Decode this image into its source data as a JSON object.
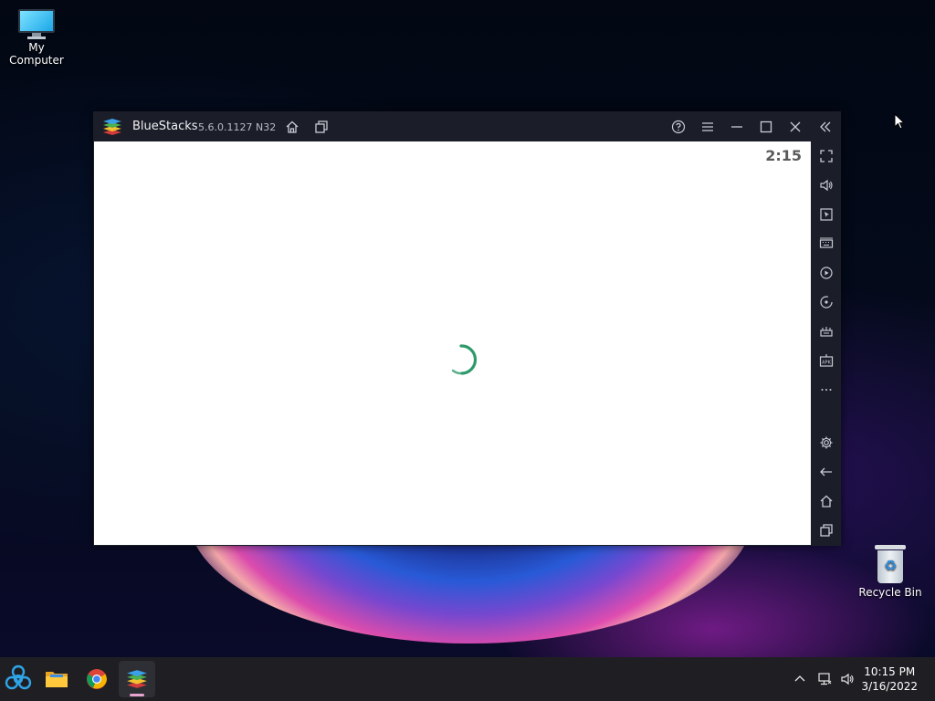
{
  "desktop": {
    "icons": [
      {
        "label": "My Computer",
        "icon": "computer-icon"
      },
      {
        "label": "Recycle Bin",
        "icon": "recycle-bin-icon"
      }
    ]
  },
  "window": {
    "app_name": "BlueStacks",
    "version": "5.6.0.1127 N32",
    "titlebar_buttons": [
      "home-icon",
      "multi-instance-icon",
      "help-icon",
      "menu-icon",
      "minimize-icon",
      "maximize-icon",
      "close-icon",
      "collapse-sidebar-icon"
    ],
    "emulator_clock": "2:15",
    "loading_spinner_color": "#2e9a6b",
    "sidebar_tools": [
      "fullscreen-icon",
      "volume-icon",
      "cursor-icon",
      "keyboard-icon",
      "macro-record-icon",
      "rotate-icon",
      "game-controls-icon",
      "apk-install-icon",
      "more-icon",
      "settings-icon",
      "back-icon",
      "home-icon",
      "recent-apps-icon"
    ]
  },
  "taskbar": {
    "apps": [
      "biohazard-start-icon",
      "file-explorer-icon",
      "chrome-icon",
      "bluestacks-icon"
    ],
    "active_app": "bluestacks-icon",
    "tray_icons": [
      "chevron-up-icon",
      "network-icon",
      "speaker-icon"
    ],
    "time": "10:15 PM",
    "date": "3/16/2022"
  },
  "colors": {
    "titlebar_bg": "#1b1e28",
    "taskbar_bg": "#1f1f23",
    "active_indicator": "#e8a4cf"
  }
}
